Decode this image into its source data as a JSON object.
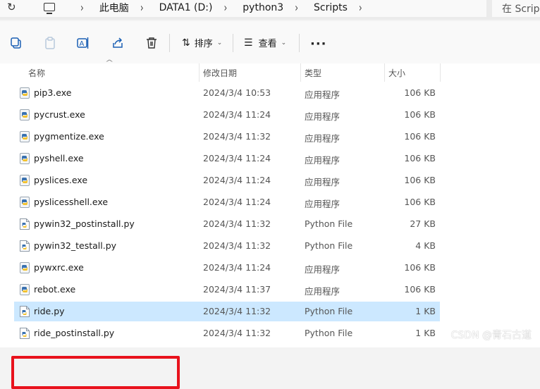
{
  "address": {
    "crumbs": [
      "此电脑",
      "DATA1 (D:)",
      "python3",
      "Scripts"
    ],
    "search_placeholder": "在 Scripts"
  },
  "toolbar": {
    "sort_label": "排序",
    "view_label": "查看",
    "more_label": "···"
  },
  "columns": {
    "name": "名称",
    "date": "修改日期",
    "type": "类型",
    "size": "大小"
  },
  "files": [
    {
      "name": "pip3.exe",
      "date": "2024/3/4 10:53",
      "type": "应用程序",
      "size": "106 KB",
      "kind": "exe"
    },
    {
      "name": "pycrust.exe",
      "date": "2024/3/4 11:24",
      "type": "应用程序",
      "size": "106 KB",
      "kind": "exe"
    },
    {
      "name": "pygmentize.exe",
      "date": "2024/3/4 11:32",
      "type": "应用程序",
      "size": "106 KB",
      "kind": "exe"
    },
    {
      "name": "pyshell.exe",
      "date": "2024/3/4 11:24",
      "type": "应用程序",
      "size": "106 KB",
      "kind": "exe"
    },
    {
      "name": "pyslices.exe",
      "date": "2024/3/4 11:24",
      "type": "应用程序",
      "size": "106 KB",
      "kind": "exe"
    },
    {
      "name": "pyslicesshell.exe",
      "date": "2024/3/4 11:24",
      "type": "应用程序",
      "size": "106 KB",
      "kind": "exe"
    },
    {
      "name": "pywin32_postinstall.py",
      "date": "2024/3/4 11:32",
      "type": "Python File",
      "size": "27 KB",
      "kind": "py"
    },
    {
      "name": "pywin32_testall.py",
      "date": "2024/3/4 11:32",
      "type": "Python File",
      "size": "4 KB",
      "kind": "py"
    },
    {
      "name": "pywxrc.exe",
      "date": "2024/3/4 11:24",
      "type": "应用程序",
      "size": "106 KB",
      "kind": "exe"
    },
    {
      "name": "rebot.exe",
      "date": "2024/3/4 11:37",
      "type": "应用程序",
      "size": "106 KB",
      "kind": "exe"
    },
    {
      "name": "ride.py",
      "date": "2024/3/4 11:32",
      "type": "Python File",
      "size": "1 KB",
      "kind": "py",
      "selected": true
    },
    {
      "name": "ride_postinstall.py",
      "date": "2024/3/4 11:32",
      "type": "Python File",
      "size": "1 KB",
      "kind": "py"
    }
  ],
  "watermark": "CSDN @青石古道",
  "colors": {
    "selection": "#cce8ff",
    "highlight_border": "#e8121c",
    "accent": "#1a5fb4"
  }
}
